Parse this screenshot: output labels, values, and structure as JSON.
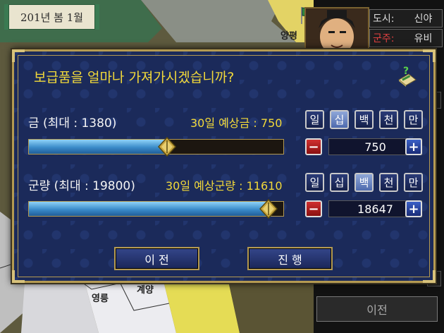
{
  "header": {
    "date": "201년 봄 1월"
  },
  "city_info": {
    "city_key": "도시:",
    "city_value": "신야",
    "ruler_key": "군주:",
    "ruler_value": "유비",
    "key_color_city": "#dddddd",
    "key_color_ruler": "#e04040"
  },
  "map": {
    "labels": [
      "양평",
      "영릉",
      "계양"
    ]
  },
  "side_button": {
    "label": "이전"
  },
  "dialog": {
    "question": "보급품을 얼마나 가져가시겠습니까?",
    "help_icon": "help-scroll-icon",
    "gold": {
      "label": "금 (최대 : 1380)",
      "estimate": "30일 예상금 : 750",
      "value": "750",
      "max": 1380,
      "amount": 750
    },
    "food": {
      "label": "군량 (최대 : 19800)",
      "estimate": "30일 예상군량 : 11610",
      "value": "18647",
      "max": 19800,
      "amount": 18647
    },
    "units": [
      "일",
      "십",
      "백",
      "천",
      "만"
    ],
    "gold_active_unit": "십",
    "food_active_unit": "백",
    "minus_label": "−",
    "plus_label": "+",
    "prev_button": "이 전",
    "next_button": "진 행"
  }
}
